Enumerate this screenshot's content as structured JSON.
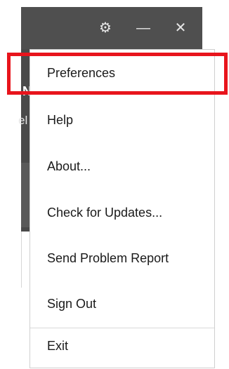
{
  "titlebar": {
    "icons": [
      "gear-icon",
      "minimize-icon",
      "close-icon"
    ],
    "gear_glyph": "⚙",
    "minimize_glyph": "—",
    "close_glyph": "✕"
  },
  "background_peek": {
    "text_1": "N",
    "text_2": "el"
  },
  "menu": {
    "items": [
      {
        "label": "Preferences"
      },
      {
        "label": "Help"
      },
      {
        "label": "About..."
      },
      {
        "label": "Check for Updates..."
      },
      {
        "label": "Send Problem Report"
      },
      {
        "label": "Sign Out"
      },
      {
        "label": "Exit"
      }
    ]
  },
  "colors": {
    "highlight": "#e8141c",
    "titlebar": "#4f4f4f",
    "menu_background": "#ffffff",
    "menu_text": "#1a1a1a"
  }
}
